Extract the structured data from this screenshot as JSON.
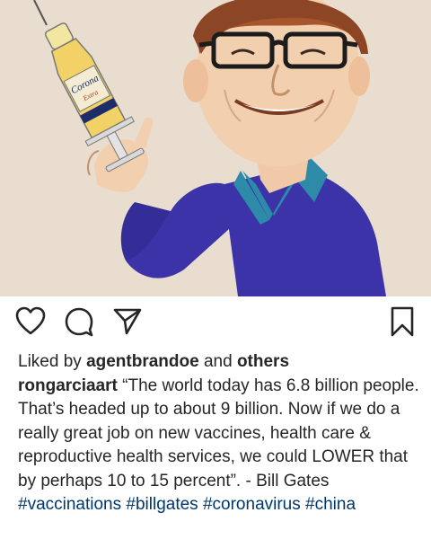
{
  "post": {
    "image_alt": "caricature holding a Corona Extra syringe",
    "bottle_label_brand": "Corona",
    "bottle_label_sub": "Extra"
  },
  "actions": {
    "like_icon": "heart-outline",
    "comment_icon": "speech-bubble",
    "share_icon": "paper-plane",
    "save_icon": "bookmark-outline"
  },
  "likes": {
    "prefix": "Liked by",
    "user": "agentbrandoe",
    "joiner": "and",
    "others": "others"
  },
  "caption": {
    "username": "rongarciaart",
    "text": "“The world today has 6.8 billion people. That’s headed up to about 9 billion. Now if we do a really great job on new vaccines, health care & reproductive health services, we could LOWER that by perhaps 10 to 15 percent”. - Bill Gates"
  },
  "hashtags": [
    "#vaccinations",
    "#billgates",
    "#coronavirus",
    "#china"
  ],
  "colors": {
    "link": "#00376b",
    "text": "#262626",
    "background": "#e7dccd",
    "sweater": "#3d33a8",
    "collar": "#2e8aa9"
  }
}
